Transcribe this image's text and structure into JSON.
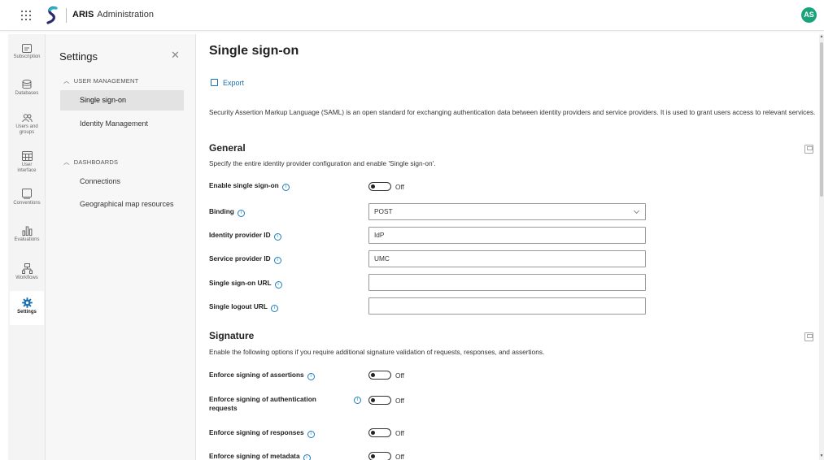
{
  "app": {
    "brand": "ARIS",
    "title": "Administration",
    "user_initials": "AS",
    "accent_color": "#1aa37a",
    "link_color": "#1a6fb3"
  },
  "rail": {
    "items": [
      {
        "label": "Subscription",
        "icon": "subscription-icon"
      },
      {
        "label": "Databases",
        "icon": "database-icon"
      },
      {
        "label": "Users and groups",
        "icon": "users-icon"
      },
      {
        "label": "User interface",
        "icon": "user-interface-icon"
      },
      {
        "label": "Conventions",
        "icon": "conventions-icon"
      },
      {
        "label": "Evaluations",
        "icon": "evaluations-icon"
      },
      {
        "label": "Workflows",
        "icon": "workflows-icon"
      },
      {
        "label": "Settings",
        "icon": "gear-icon",
        "active": true
      }
    ]
  },
  "settings_panel": {
    "title": "Settings",
    "groups": [
      {
        "label": "USER MANAGEMENT",
        "items": [
          "Single sign-on",
          "Identity Management"
        ],
        "selected": "Single sign-on"
      },
      {
        "label": "DASHBOARDS",
        "items": [
          "Connections",
          "Geographical map resources"
        ]
      }
    ]
  },
  "main": {
    "title": "Single sign-on",
    "export_label": "Export",
    "intro": "Security Assertion Markup Language (SAML) is an open standard for exchanging authentication data between identity providers and service providers. It is used to grant users access to relevant services.",
    "general": {
      "title": "General",
      "description": "Specify the entire identity provider configuration and enable 'Single sign-on'.",
      "enable_sso": {
        "label": "Enable single sign-on",
        "state": "Off"
      },
      "binding": {
        "label": "Binding",
        "value": "POST"
      },
      "idp_id": {
        "label": "Identity provider ID",
        "value": "IdP"
      },
      "sp_id": {
        "label": "Service provider ID",
        "value": "UMC"
      },
      "sso_url": {
        "label": "Single sign-on URL",
        "value": ""
      },
      "slo_url": {
        "label": "Single logout URL",
        "value": ""
      }
    },
    "signature": {
      "title": "Signature",
      "description": "Enable the following options if you require additional signature validation of requests, responses, and assertions.",
      "assertions": {
        "label": "Enforce signing of assertions",
        "state": "Off"
      },
      "auth_requests": {
        "label_line1": "Enforce signing of authentication",
        "label_line2": "requests",
        "state": "Off"
      },
      "responses": {
        "label": "Enforce signing of responses",
        "state": "Off"
      },
      "metadata": {
        "label": "Enforce signing of metadata",
        "state": "Off"
      }
    }
  }
}
